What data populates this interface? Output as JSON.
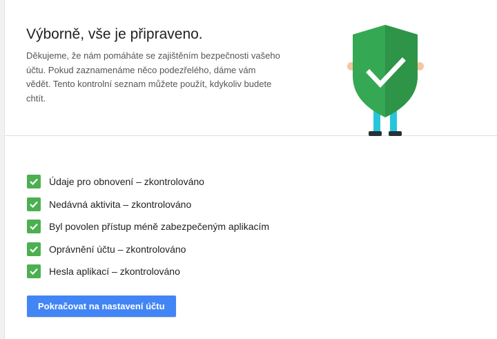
{
  "header": {
    "title": "Výborně, vše je připraveno.",
    "description": "Děkujeme, že nám pomáháte se zajištěním bezpečnosti vašeho účtu. Pokud zaznamenáme něco podezřelého, dáme vám vědět. Tento kontrolní seznam můžete použít, kdykoliv budete chtít."
  },
  "illustration": {
    "icon": "shield-check-person",
    "shield_color": "#34a853"
  },
  "checklist": [
    {
      "label": "Údaje pro obnovení – zkontrolováno",
      "checked": true
    },
    {
      "label": "Nedávná aktivita – zkontrolováno",
      "checked": true
    },
    {
      "label": "Byl povolen přístup méně zabezpečeným aplikacím",
      "checked": true
    },
    {
      "label": "Oprávnění účtu – zkontrolováno",
      "checked": true
    },
    {
      "label": "Hesla aplikací – zkontrolováno",
      "checked": true
    }
  ],
  "actions": {
    "continue_label": "Pokračovat na nastavení účtu"
  },
  "colors": {
    "accent": "#4285f4",
    "check": "#4caf50"
  }
}
